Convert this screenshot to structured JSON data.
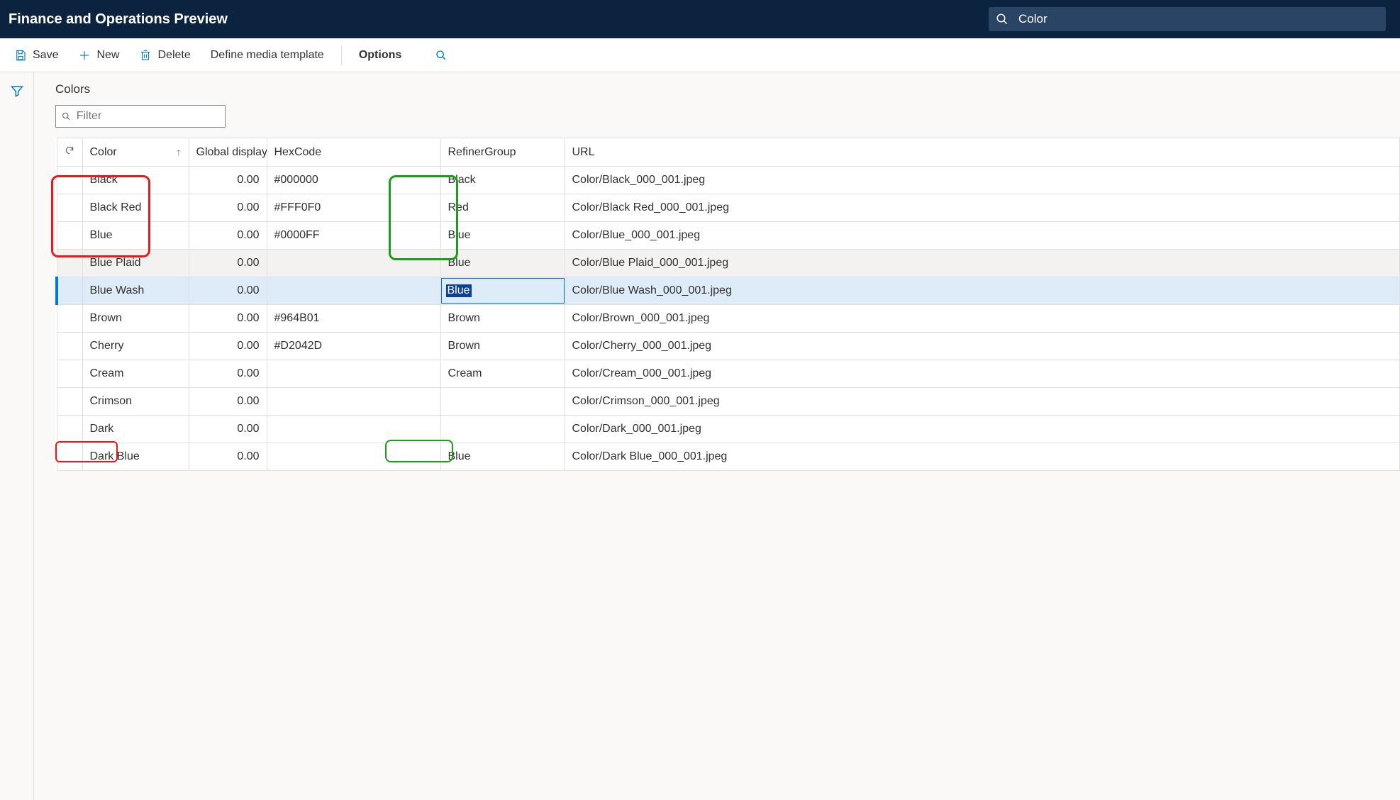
{
  "topbar": {
    "title": "Finance and Operations Preview",
    "search_text": "Color"
  },
  "commands": {
    "save": "Save",
    "new": "New",
    "delete": "Delete",
    "define": "Define media template",
    "options": "Options"
  },
  "section_title": "Colors",
  "filter_placeholder": "Filter",
  "columns": {
    "color": "Color",
    "global": "Global display ...",
    "hex": "HexCode",
    "refiner": "RefinerGroup",
    "url": "URL"
  },
  "rows": [
    {
      "color": "Black",
      "global": "0.00",
      "hex": "#000000",
      "refiner": "Black",
      "url": "Color/Black_000_001.jpeg",
      "state": ""
    },
    {
      "color": "Black Red",
      "global": "0.00",
      "hex": "#FFF0F0",
      "refiner": "Red",
      "url": "Color/Black Red_000_001.jpeg",
      "state": ""
    },
    {
      "color": "Blue",
      "global": "0.00",
      "hex": "#0000FF",
      "refiner": "Blue",
      "url": "Color/Blue_000_001.jpeg",
      "state": ""
    },
    {
      "color": "Blue Plaid",
      "global": "0.00",
      "hex": "",
      "refiner": "Blue",
      "url": "Color/Blue Plaid_000_001.jpeg",
      "state": "alt"
    },
    {
      "color": "Blue Wash",
      "global": "0.00",
      "hex": "",
      "refiner": "Blue",
      "url": "Color/Blue Wash_000_001.jpeg",
      "state": "selected editing"
    },
    {
      "color": "Brown",
      "global": "0.00",
      "hex": "#964B01",
      "refiner": "Brown",
      "url": "Color/Brown_000_001.jpeg",
      "state": ""
    },
    {
      "color": "Cherry",
      "global": "0.00",
      "hex": "#D2042D",
      "refiner": "Brown",
      "url": "Color/Cherry_000_001.jpeg",
      "state": ""
    },
    {
      "color": "Cream",
      "global": "0.00",
      "hex": "",
      "refiner": "Cream",
      "url": "Color/Cream_000_001.jpeg",
      "state": ""
    },
    {
      "color": "Crimson",
      "global": "0.00",
      "hex": "",
      "refiner": "",
      "url": "Color/Crimson_000_001.jpeg",
      "state": ""
    },
    {
      "color": "Dark",
      "global": "0.00",
      "hex": "",
      "refiner": "",
      "url": "Color/Dark_000_001.jpeg",
      "state": ""
    },
    {
      "color": "Dark Blue",
      "global": "0.00",
      "hex": "",
      "refiner": "Blue",
      "url": "Color/Dark Blue_000_001.jpeg",
      "state": ""
    }
  ]
}
